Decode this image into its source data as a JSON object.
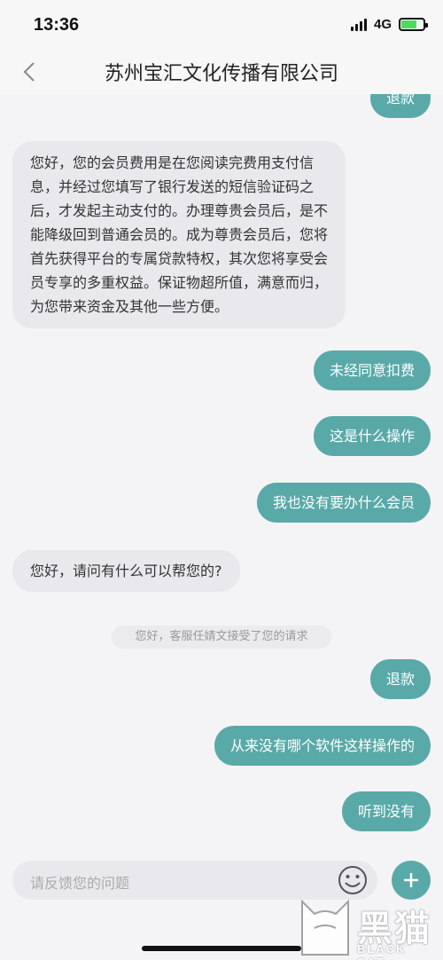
{
  "status_bar": {
    "time": "13:36",
    "network": "4G"
  },
  "header": {
    "title": "苏州宝汇文化传播有限公司"
  },
  "messages": [
    {
      "side": "out",
      "text": "退款"
    },
    {
      "side": "in",
      "text": "您好，您的会员费用是在您阅读完费用支付信息，并经过您填写了银行发送的短信验证码之后，才发起主动支付的。办理尊贵会员后，是不能降级回到普通会员的。成为尊贵会员后，您将首先获得平台的专属贷款特权，其次您将享受会员专享的多重权益。保证物超所值，满意而归，为您带来资金及其他一些方便。"
    },
    {
      "side": "out",
      "text": "未经同意扣费"
    },
    {
      "side": "out",
      "text": "这是什么操作"
    },
    {
      "side": "out",
      "text": "我也没有要办什么会员"
    },
    {
      "side": "in",
      "text": "您好，请问有什么可以帮您的?"
    },
    {
      "side": "out",
      "text": "退款"
    },
    {
      "side": "out",
      "text": "从来没有哪个软件这样操作的"
    },
    {
      "side": "out",
      "text": "听到没有"
    }
  ],
  "system_note": "您好，客服任婧文接受了您的请求",
  "input": {
    "placeholder": "请反馈您的问题"
  },
  "watermark": {
    "text": "黑猫",
    "sub": "BLACK CAT"
  },
  "colors": {
    "accent": "#5aa9a9",
    "incoming_bubble": "#e9e9ed",
    "background": "#f4f4f6"
  },
  "icons": [
    "back-chevron-icon",
    "emoji-icon",
    "plus-icon",
    "signal-icon",
    "battery-charging-icon"
  ]
}
